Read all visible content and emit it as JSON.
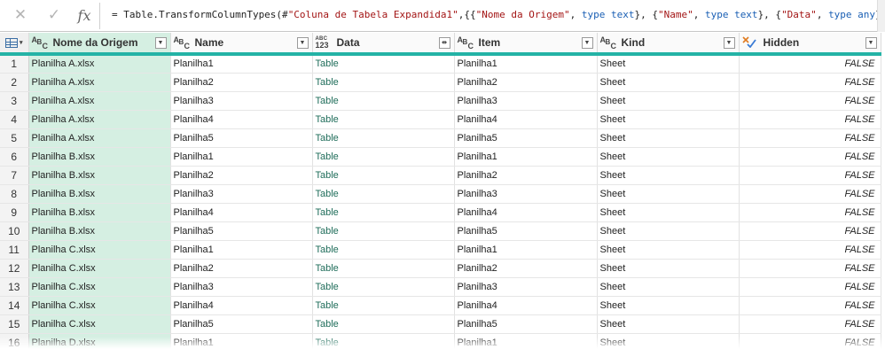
{
  "formula_bar": {
    "cancel_icon": "close-icon",
    "confirm_icon": "check-icon",
    "fx_label": "fx",
    "formula_parts": [
      {
        "t": "= Table.TransformColumnTypes(#",
        "c": ""
      },
      {
        "t": "\"Coluna de Tabela Expandida1\"",
        "c": "s"
      },
      {
        "t": ",{{",
        "c": ""
      },
      {
        "t": "\"Nome da Origem\"",
        "c": "s"
      },
      {
        "t": ", ",
        "c": ""
      },
      {
        "t": "type text",
        "c": "k"
      },
      {
        "t": "}, {",
        "c": ""
      },
      {
        "t": "\"Name\"",
        "c": "s"
      },
      {
        "t": ", ",
        "c": ""
      },
      {
        "t": "type text",
        "c": "k"
      },
      {
        "t": "}, {",
        "c": ""
      },
      {
        "t": "\"Data\"",
        "c": "s"
      },
      {
        "t": ", ",
        "c": ""
      },
      {
        "t": "type any",
        "c": "k"
      },
      {
        "t": "},",
        "c": ""
      }
    ]
  },
  "columns": [
    {
      "label": "Nome da Origem",
      "type": "text"
    },
    {
      "label": "Name",
      "type": "text"
    },
    {
      "label": "Data",
      "type": "table"
    },
    {
      "label": "Item",
      "type": "text"
    },
    {
      "label": "Kind",
      "type": "text"
    },
    {
      "label": "Hidden",
      "type": "logical"
    }
  ],
  "type_icons": {
    "text": [
      "A",
      "B",
      "C"
    ],
    "table": [
      "ABC",
      "123"
    ]
  },
  "rows": [
    [
      "1",
      "Planilha A.xlsx",
      "Planilha1",
      "Table",
      "Planilha1",
      "Sheet",
      "FALSE"
    ],
    [
      "2",
      "Planilha A.xlsx",
      "Planilha2",
      "Table",
      "Planilha2",
      "Sheet",
      "FALSE"
    ],
    [
      "3",
      "Planilha A.xlsx",
      "Planilha3",
      "Table",
      "Planilha3",
      "Sheet",
      "FALSE"
    ],
    [
      "4",
      "Planilha A.xlsx",
      "Planilha4",
      "Table",
      "Planilha4",
      "Sheet",
      "FALSE"
    ],
    [
      "5",
      "Planilha A.xlsx",
      "Planilha5",
      "Table",
      "Planilha5",
      "Sheet",
      "FALSE"
    ],
    [
      "6",
      "Planilha B.xlsx",
      "Planilha1",
      "Table",
      "Planilha1",
      "Sheet",
      "FALSE"
    ],
    [
      "7",
      "Planilha B.xlsx",
      "Planilha2",
      "Table",
      "Planilha2",
      "Sheet",
      "FALSE"
    ],
    [
      "8",
      "Planilha B.xlsx",
      "Planilha3",
      "Table",
      "Planilha3",
      "Sheet",
      "FALSE"
    ],
    [
      "9",
      "Planilha B.xlsx",
      "Planilha4",
      "Table",
      "Planilha4",
      "Sheet",
      "FALSE"
    ],
    [
      "10",
      "Planilha B.xlsx",
      "Planilha5",
      "Table",
      "Planilha5",
      "Sheet",
      "FALSE"
    ],
    [
      "11",
      "Planilha C.xlsx",
      "Planilha1",
      "Table",
      "Planilha1",
      "Sheet",
      "FALSE"
    ],
    [
      "12",
      "Planilha C.xlsx",
      "Planilha2",
      "Table",
      "Planilha2",
      "Sheet",
      "FALSE"
    ],
    [
      "13",
      "Planilha C.xlsx",
      "Planilha3",
      "Table",
      "Planilha3",
      "Sheet",
      "FALSE"
    ],
    [
      "14",
      "Planilha C.xlsx",
      "Planilha4",
      "Table",
      "Planilha4",
      "Sheet",
      "FALSE"
    ],
    [
      "15",
      "Planilha C.xlsx",
      "Planilha5",
      "Table",
      "Planilha5",
      "Sheet",
      "FALSE"
    ],
    [
      "16",
      "Planilha D.xlsx",
      "Planilha1",
      "Table",
      "Planilha1",
      "Sheet",
      "FALSE"
    ]
  ],
  "colors": {
    "accent_teal": "#24b3a6",
    "selected_column": "#d5efe2",
    "data_cell_text": "#1f6d5a",
    "keyword": "#1a5fb4",
    "string": "#a31515"
  }
}
